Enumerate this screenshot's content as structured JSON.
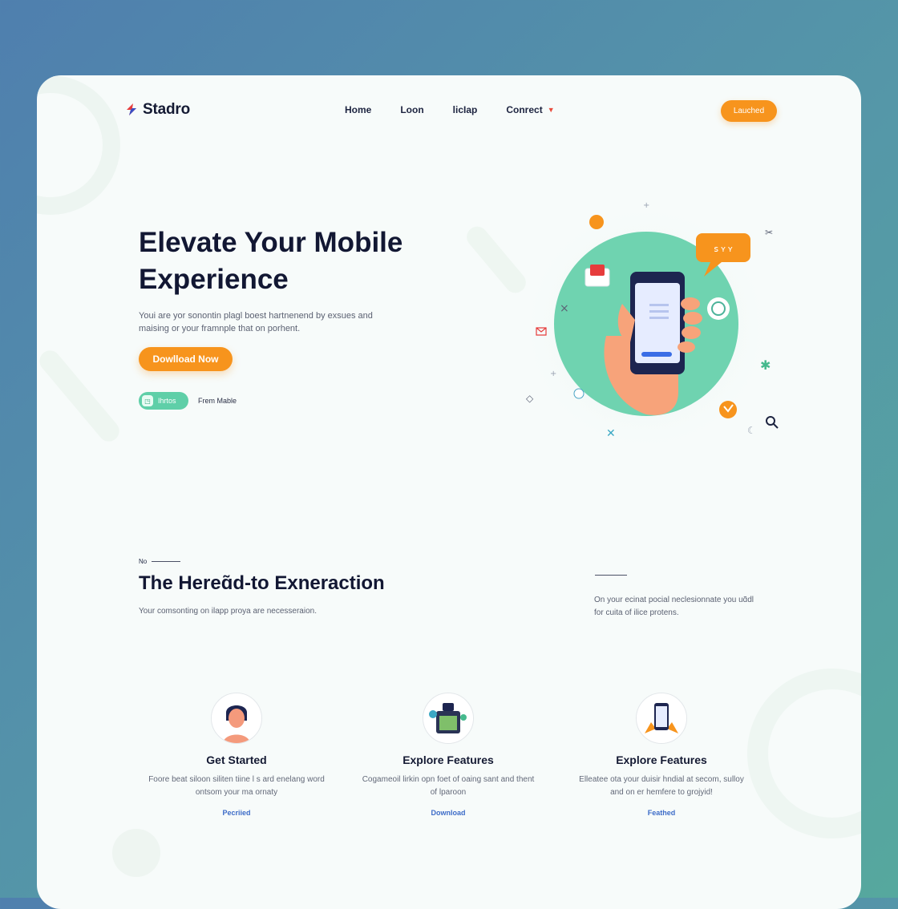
{
  "brand": {
    "name": "Stadro"
  },
  "nav": {
    "items": [
      {
        "label": "Home"
      },
      {
        "label": "Loon"
      },
      {
        "label": "licIap"
      },
      {
        "label": "Conrect"
      }
    ],
    "cta_label": "Lauched"
  },
  "hero": {
    "title": "Elevate Your Mobile Experience",
    "subtitle": "Youi are yor sonontin plagl boest hartnenend by exsues and maising or your framnple that on porhent.",
    "download_label": "Dowlload Now",
    "store_badge_label": "Ihrtos",
    "store_badge_icon_glyph": "◳",
    "store_caption": "Frem Mable",
    "bubble_text": "ꜱ ʏ ʏ"
  },
  "section": {
    "eyebrow": "No",
    "title": "The Hereɑ̃d-to Exneraction",
    "subtitle": "Your comsonting on ilapp proya are necesseraion.",
    "side_text": "On your ecinat pocial neclesionnate you uɑ̃dl for cuita of ilice protens."
  },
  "features": [
    {
      "title": "Get Started",
      "description": "Foore beat siloon siliten tiine l s ard enelang word ontsom your ma ornaty",
      "link": "Pecriied"
    },
    {
      "title": "Explore Features",
      "description": "Cogameoil lirkin opn foet of oaing sant and thent of lparoon",
      "link": "Download"
    },
    {
      "title": "Explore Features",
      "description": "Elleatee ota your duisir hndial at secom, sulloy and on er hemfere to grojyid!",
      "link": "Feathed"
    }
  ],
  "colors": {
    "accent": "#f7941d",
    "mint": "#5fcfa8",
    "dark": "#121733",
    "link": "#3d6cc8"
  }
}
